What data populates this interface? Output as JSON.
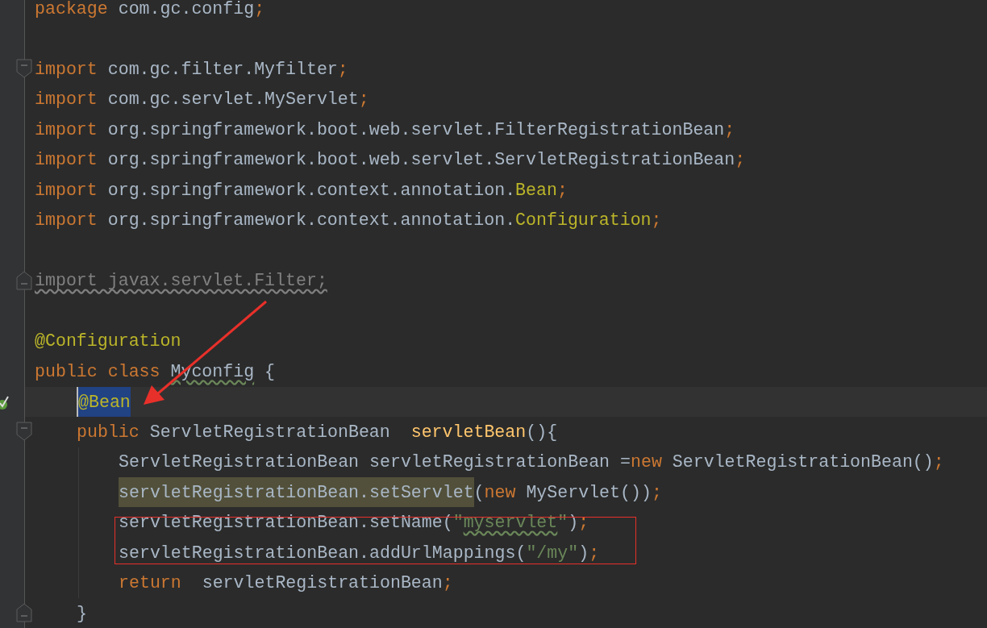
{
  "editor": {
    "lines": [
      {
        "kind": "code",
        "tokens": [
          {
            "text": "package",
            "kind": "keyword"
          },
          {
            "text": " com.gc.config",
            "kind": "plain"
          },
          {
            "text": ";",
            "kind": "punct"
          }
        ]
      },
      {
        "kind": "blank"
      },
      {
        "kind": "code",
        "fold_start": true,
        "tokens": [
          {
            "text": "import",
            "kind": "keyword"
          },
          {
            "text": " com.gc.filter.Myfilter",
            "kind": "plain"
          },
          {
            "text": ";",
            "kind": "punct"
          }
        ]
      },
      {
        "kind": "code",
        "tokens": [
          {
            "text": "import",
            "kind": "keyword"
          },
          {
            "text": " com.gc.servlet.MyServlet",
            "kind": "plain"
          },
          {
            "text": ";",
            "kind": "punct"
          }
        ]
      },
      {
        "kind": "code",
        "tokens": [
          {
            "text": "import",
            "kind": "keyword"
          },
          {
            "text": " org.springframework.boot.web.servlet.FilterRegistrationBean",
            "kind": "plain"
          },
          {
            "text": ";",
            "kind": "punct"
          }
        ]
      },
      {
        "kind": "code",
        "tokens": [
          {
            "text": "import",
            "kind": "keyword"
          },
          {
            "text": " org.springframework.boot.web.servlet.ServletRegistrationBean",
            "kind": "plain"
          },
          {
            "text": ";",
            "kind": "punct"
          }
        ]
      },
      {
        "kind": "code",
        "tokens": [
          {
            "text": "import",
            "kind": "keyword"
          },
          {
            "text": " org.springframework.context.annotation.",
            "kind": "plain"
          },
          {
            "text": "Bean",
            "kind": "annotation"
          },
          {
            "text": ";",
            "kind": "punct"
          }
        ]
      },
      {
        "kind": "code",
        "tokens": [
          {
            "text": "import",
            "kind": "keyword"
          },
          {
            "text": " org.springframework.context.annotation.",
            "kind": "plain"
          },
          {
            "text": "Configuration",
            "kind": "annotation"
          },
          {
            "text": ";",
            "kind": "punct"
          }
        ]
      },
      {
        "kind": "blank"
      },
      {
        "kind": "code",
        "fold_end": true,
        "tokens": [
          {
            "text": "import javax.servlet.Filter;",
            "kind": "unused",
            "warning": true
          }
        ]
      },
      {
        "kind": "blank"
      },
      {
        "kind": "code",
        "tokens": [
          {
            "text": "@Configuration",
            "kind": "annotation"
          }
        ]
      },
      {
        "kind": "code",
        "tokens": [
          {
            "text": "public class ",
            "kind": "keyword"
          },
          {
            "text": "Myconfig",
            "kind": "plain",
            "warning": true
          },
          {
            "text": " {",
            "kind": "plain"
          }
        ],
        "children": [
          {
            "kind": "code",
            "current": true,
            "bean_marker": true,
            "tokens": [
              {
                "text": "@Bean",
                "kind": "annotation",
                "selected": true
              }
            ]
          },
          {
            "kind": "code",
            "fold_start": true,
            "tokens": [
              {
                "text": "public",
                "kind": "keyword"
              },
              {
                "text": " ServletRegistrationBean  ",
                "kind": "plain"
              },
              {
                "text": "servletBean",
                "kind": "method"
              },
              {
                "text": "(){",
                "kind": "plain"
              }
            ],
            "children": [
              {
                "kind": "code",
                "tokens": [
                  {
                    "text": "ServletRegistrationBean servletRegistrationBean =",
                    "kind": "plain"
                  },
                  {
                    "text": "new",
                    "kind": "keyword"
                  },
                  {
                    "text": " ServletRegistrationBean()",
                    "kind": "plain"
                  },
                  {
                    "text": ";",
                    "kind": "punct"
                  }
                ]
              },
              {
                "kind": "code",
                "tokens": [
                  {
                    "text": "servletRegistrationBean.setServlet",
                    "kind": "plain",
                    "highlighted": true
                  },
                  {
                    "text": "(",
                    "kind": "plain"
                  },
                  {
                    "text": "new",
                    "kind": "keyword"
                  },
                  {
                    "text": " MyServlet())",
                    "kind": "plain"
                  },
                  {
                    "text": ";",
                    "kind": "punct"
                  }
                ]
              },
              {
                "kind": "code",
                "tokens": [
                  {
                    "text": "servletRegistrationBean.setName(",
                    "kind": "plain"
                  },
                  {
                    "text": "\"",
                    "kind": "string"
                  },
                  {
                    "text": "myservlet",
                    "kind": "string",
                    "warning": true
                  },
                  {
                    "text": "\"",
                    "kind": "string"
                  },
                  {
                    "text": ")",
                    "kind": "plain"
                  },
                  {
                    "text": ";",
                    "kind": "punct"
                  }
                ]
              },
              {
                "kind": "code",
                "tokens": [
                  {
                    "text": "servletRegistrationBean.addUrlMappings(",
                    "kind": "plain"
                  },
                  {
                    "text": "\"/my\"",
                    "kind": "string"
                  },
                  {
                    "text": ")",
                    "kind": "plain"
                  },
                  {
                    "text": ";",
                    "kind": "punct"
                  }
                ]
              },
              {
                "kind": "code",
                "tokens": [
                  {
                    "text": "return",
                    "kind": "keyword"
                  },
                  {
                    "text": "  servletRegistrationBean",
                    "kind": "plain"
                  },
                  {
                    "text": ";",
                    "kind": "punct"
                  }
                ]
              }
            ]
          },
          {
            "kind": "code",
            "fold_end": true,
            "tokens": [
              {
                "text": "}",
                "kind": "plain"
              }
            ]
          }
        ]
      }
    ]
  }
}
